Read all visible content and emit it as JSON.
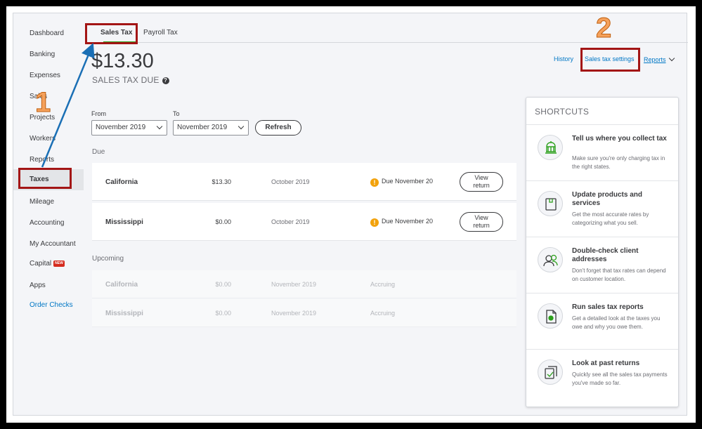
{
  "sidebar": {
    "items": [
      {
        "label": "Dashboard"
      },
      {
        "label": "Banking"
      },
      {
        "label": "Expenses"
      },
      {
        "label": "Sales"
      },
      {
        "label": "Projects"
      },
      {
        "label": "Workers"
      },
      {
        "label": "Reports"
      },
      {
        "label": "Taxes"
      },
      {
        "label": "Mileage"
      },
      {
        "label": "Accounting"
      },
      {
        "label": "My Accountant"
      },
      {
        "label": "Capital"
      },
      {
        "label": "Apps"
      },
      {
        "label": "Order Checks"
      }
    ],
    "new_badge": "NEW"
  },
  "tabs": [
    {
      "label": "Sales Tax"
    },
    {
      "label": "Payroll Tax"
    }
  ],
  "summary": {
    "amount": "$13.30",
    "label": "SALES TAX DUE",
    "help_icon": "?"
  },
  "top_links": {
    "history": "History",
    "settings": "Sales tax settings",
    "reports": "Reports"
  },
  "filters": {
    "from_label": "From",
    "from_value": "November 2019",
    "to_label": "To",
    "to_value": "November 2019",
    "refresh": "Refresh"
  },
  "due": {
    "title": "Due",
    "rows": [
      {
        "state": "California",
        "amount": "$13.30",
        "period": "October 2019",
        "status": "Due November 20",
        "action_line1": "View",
        "action_line2": "return"
      },
      {
        "state": "Mississippi",
        "amount": "$0.00",
        "period": "October 2019",
        "status": "Due November 20",
        "action_line1": "View",
        "action_line2": "return"
      }
    ]
  },
  "upcoming": {
    "title": "Upcoming",
    "rows": [
      {
        "state": "California",
        "amount": "$0.00",
        "period": "November 2019",
        "status": "Accruing"
      },
      {
        "state": "Mississippi",
        "amount": "$0.00",
        "period": "November 2019",
        "status": "Accruing"
      }
    ]
  },
  "shortcuts": {
    "title": "SHORTCUTS",
    "items": [
      {
        "title": "Tell us where you collect tax",
        "desc": "Make sure you're only charging tax in the right states.",
        "icon": "capitol-building-icon"
      },
      {
        "title": "Update products and services",
        "desc": "Get the most accurate rates by categorizing what you sell.",
        "icon": "product-box-icon"
      },
      {
        "title": "Double-check client addresses",
        "desc": "Don't forget that tax rates can depend on customer location.",
        "icon": "clients-icon"
      },
      {
        "title": "Run sales tax reports",
        "desc": "Get a detailed look at the taxes you owe and why you owe them.",
        "icon": "report-document-icon"
      },
      {
        "title": "Look at past returns",
        "desc": "Quickly see all the sales tax payments you've made so far.",
        "icon": "past-returns-icon"
      }
    ]
  },
  "annotations": {
    "step1": "1",
    "step2": "2"
  },
  "colors": {
    "accent": "#0077c5",
    "tab_underline": "#2ca01c",
    "highlight": "#a31515",
    "warning": "#f2a20c",
    "step_number": "#f5a15b"
  }
}
